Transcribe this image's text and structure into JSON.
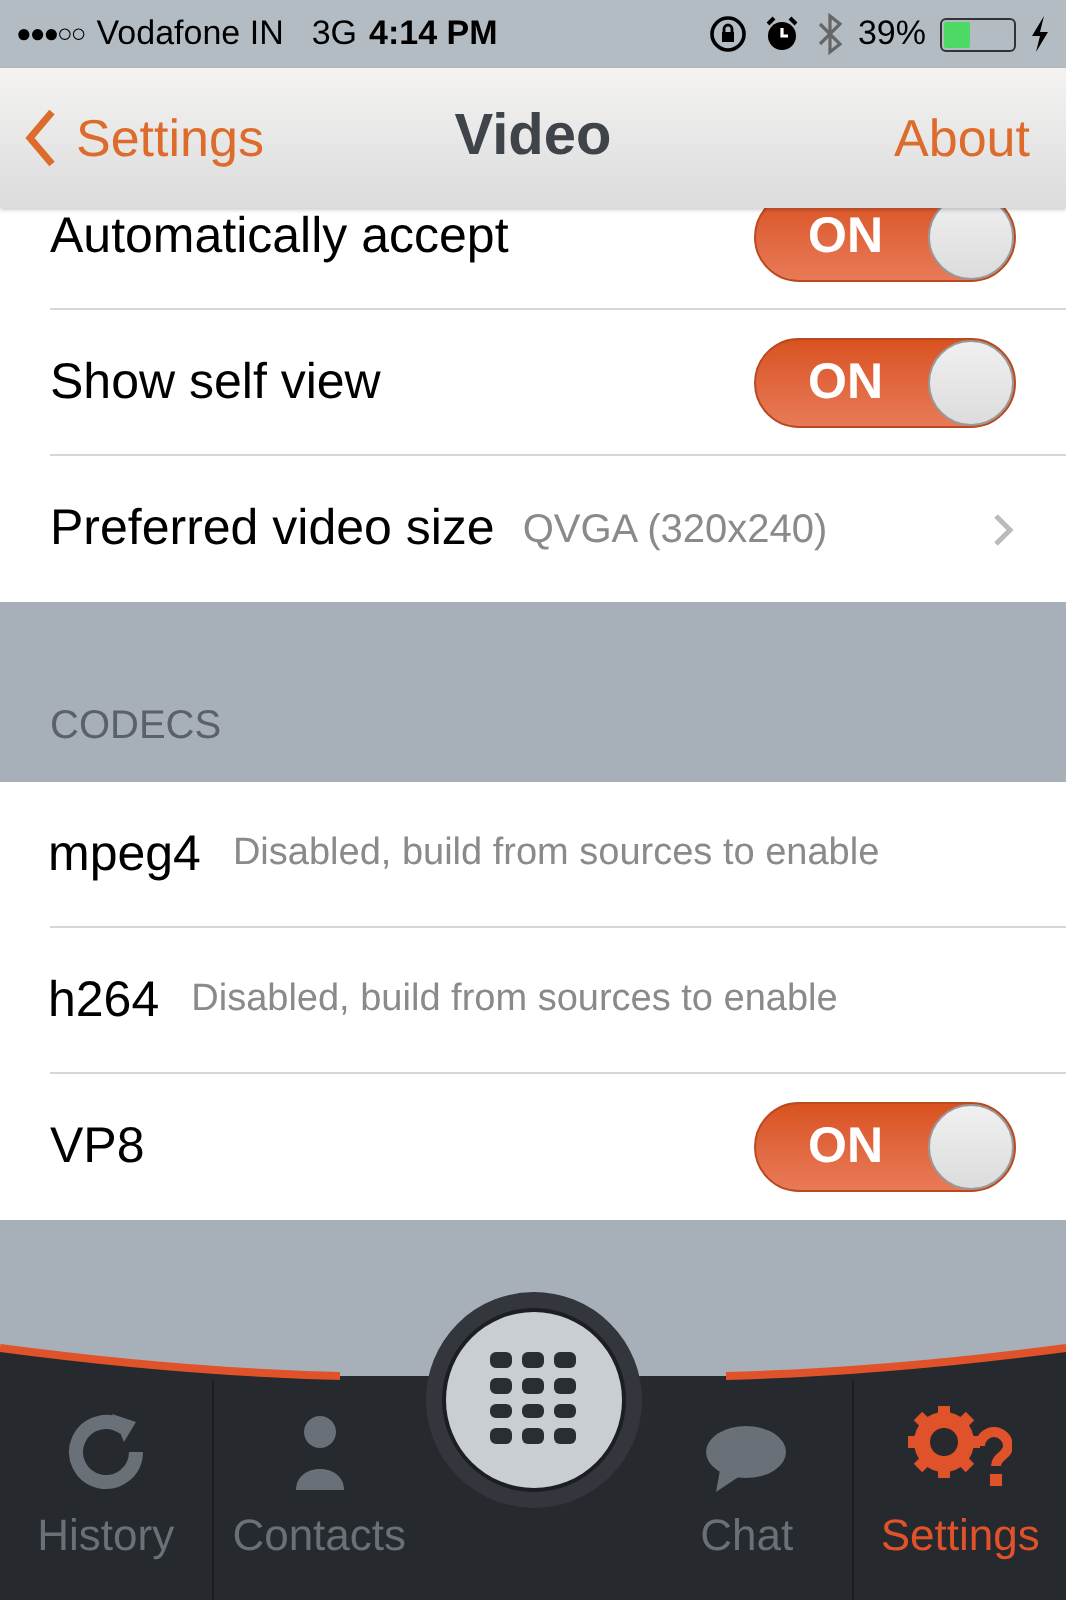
{
  "status_bar": {
    "signal_dots": "●●●○○",
    "carrier": "Vodafone IN",
    "network": "3G",
    "time": "4:14 PM",
    "battery": "39%"
  },
  "nav": {
    "back": "Settings",
    "title": "Video",
    "action": "About"
  },
  "video_rows": [
    {
      "kind": "toggle",
      "label": "Automatically accept",
      "on": true,
      "switch_text": "ON"
    },
    {
      "kind": "toggle",
      "label": "Show self view",
      "on": true,
      "switch_text": "ON"
    },
    {
      "kind": "link",
      "label": "Preferred video size",
      "value": "QVGA (320x240)"
    }
  ],
  "codecs": {
    "header": "CODECS",
    "rows": [
      {
        "kind": "note",
        "label": "mpeg4",
        "note": "Disabled, build from sources to enable"
      },
      {
        "kind": "note",
        "label": "h264",
        "note": "Disabled, build from sources to enable"
      },
      {
        "kind": "toggle",
        "label": "VP8",
        "on": true,
        "switch_text": "ON"
      }
    ]
  },
  "tabs": [
    {
      "kind": "history",
      "label": "History",
      "selected": false
    },
    {
      "kind": "contacts",
      "label": "Contacts",
      "selected": false
    },
    {
      "kind": "dialer",
      "selected": false
    },
    {
      "kind": "chat",
      "label": "Chat",
      "selected": false
    },
    {
      "kind": "settings",
      "label": "Settings",
      "selected": true
    }
  ]
}
